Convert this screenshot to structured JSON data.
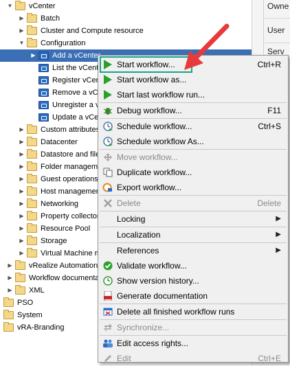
{
  "tree": [
    {
      "label": "vCenter",
      "indent": 0,
      "type": "folder",
      "twisty": "▼",
      "sel": false
    },
    {
      "label": "Batch",
      "indent": 1,
      "type": "folder",
      "twisty": "▶",
      "sel": false
    },
    {
      "label": "Cluster and Compute resource",
      "indent": 1,
      "type": "folder",
      "twisty": "▶",
      "sel": false
    },
    {
      "label": "Configuration",
      "indent": 1,
      "type": "folder",
      "twisty": "▼",
      "sel": false
    },
    {
      "label": "Add a vCenter",
      "indent": 2,
      "type": "wf",
      "twisty": "▶",
      "sel": true
    },
    {
      "label": "List the vCente",
      "indent": 2,
      "type": "wf",
      "twisty": "",
      "sel": false
    },
    {
      "label": "Register vCent",
      "indent": 2,
      "type": "wf",
      "twisty": "",
      "sel": false
    },
    {
      "label": "Remove a vCe",
      "indent": 2,
      "type": "wf",
      "twisty": "",
      "sel": false
    },
    {
      "label": "Unregister a v",
      "indent": 2,
      "type": "wf",
      "twisty": "",
      "sel": false
    },
    {
      "label": "Update a vCen",
      "indent": 2,
      "type": "wf",
      "twisty": "",
      "sel": false
    },
    {
      "label": "Custom attributes",
      "indent": 1,
      "type": "folder",
      "twisty": "▶",
      "sel": false
    },
    {
      "label": "Datacenter",
      "indent": 1,
      "type": "folder",
      "twisty": "▶",
      "sel": false
    },
    {
      "label": "Datastore and file",
      "indent": 1,
      "type": "folder",
      "twisty": "▶",
      "sel": false
    },
    {
      "label": "Folder manageme",
      "indent": 1,
      "type": "folder",
      "twisty": "▶",
      "sel": false
    },
    {
      "label": "Guest operations",
      "indent": 1,
      "type": "folder",
      "twisty": "▶",
      "sel": false
    },
    {
      "label": "Host management",
      "indent": 1,
      "type": "folder",
      "twisty": "▶",
      "sel": false
    },
    {
      "label": "Networking",
      "indent": 1,
      "type": "folder",
      "twisty": "▶",
      "sel": false
    },
    {
      "label": "Property collector",
      "indent": 1,
      "type": "folder",
      "twisty": "▶",
      "sel": false
    },
    {
      "label": "Resource Pool",
      "indent": 1,
      "type": "folder",
      "twisty": "▶",
      "sel": false
    },
    {
      "label": "Storage",
      "indent": 1,
      "type": "folder",
      "twisty": "▶",
      "sel": false
    },
    {
      "label": "Virtual Machine m",
      "indent": 1,
      "type": "folder",
      "twisty": "▶",
      "sel": false
    },
    {
      "label": "vRealize Automation",
      "indent": 0,
      "type": "folder",
      "twisty": "▶",
      "sel": false
    },
    {
      "label": "Workflow documenta",
      "indent": 0,
      "type": "folder",
      "twisty": "▶",
      "sel": false
    },
    {
      "label": "XML",
      "indent": 0,
      "type": "folder",
      "twisty": "▶",
      "sel": false
    },
    {
      "label": "PSO",
      "indent": -1,
      "type": "folder",
      "twisty": "",
      "sel": false
    },
    {
      "label": "System",
      "indent": -1,
      "type": "folder",
      "twisty": "",
      "sel": false
    },
    {
      "label": "vRA-Branding",
      "indent": -1,
      "type": "folder",
      "twisty": "",
      "sel": false
    }
  ],
  "right_panel": {
    "owner": "Owne",
    "user": "User",
    "serv": "Serv"
  },
  "menu": [
    {
      "label": "Start workflow...",
      "shortcut": "Ctrl+R",
      "icon": "play-icon",
      "disabled": false,
      "sub": false
    },
    {
      "label": "Start workflow as...",
      "shortcut": "",
      "icon": "play-icon",
      "disabled": false,
      "sub": false
    },
    {
      "label": "Start last workflow run...",
      "shortcut": "",
      "icon": "play-icon",
      "disabled": false,
      "sub": false
    },
    {
      "sep": true
    },
    {
      "label": "Debug workflow...",
      "shortcut": "F11",
      "icon": "bug-icon",
      "disabled": false,
      "sub": false
    },
    {
      "sep": true
    },
    {
      "label": "Schedule workflow...",
      "shortcut": "Ctrl+S",
      "icon": "clock-icon",
      "disabled": false,
      "sub": false
    },
    {
      "label": "Schedule workflow As...",
      "shortcut": "",
      "icon": "clock-icon",
      "disabled": false,
      "sub": false
    },
    {
      "sep": true
    },
    {
      "label": "Move workflow...",
      "shortcut": "",
      "icon": "move-icon",
      "disabled": true,
      "sub": false
    },
    {
      "label": "Duplicate workflow...",
      "shortcut": "",
      "icon": "duplicate-icon",
      "disabled": false,
      "sub": false
    },
    {
      "label": "Export workflow...",
      "shortcut": "",
      "icon": "export-icon",
      "disabled": false,
      "sub": false
    },
    {
      "sep": true
    },
    {
      "label": "Delete",
      "shortcut": "Delete",
      "icon": "delete-x-icon",
      "disabled": true,
      "sub": false
    },
    {
      "sep": true
    },
    {
      "label": "Locking",
      "shortcut": "",
      "icon": "",
      "disabled": false,
      "sub": true
    },
    {
      "sep": true
    },
    {
      "label": "Localization",
      "shortcut": "",
      "icon": "",
      "disabled": false,
      "sub": true
    },
    {
      "sep": true
    },
    {
      "label": "References",
      "shortcut": "",
      "icon": "",
      "disabled": false,
      "sub": true
    },
    {
      "label": "Validate workflow...",
      "shortcut": "",
      "icon": "check-icon",
      "disabled": false,
      "sub": false
    },
    {
      "label": "Show version history...",
      "shortcut": "",
      "icon": "history-icon",
      "disabled": false,
      "sub": false
    },
    {
      "label": "Generate documentation",
      "shortcut": "",
      "icon": "pdf-icon",
      "disabled": false,
      "sub": false
    },
    {
      "sep": true
    },
    {
      "label": "Delete all finished workflow runs",
      "shortcut": "",
      "icon": "delete-runs-icon",
      "disabled": false,
      "sub": false
    },
    {
      "sep": true
    },
    {
      "label": "Synchronize...",
      "shortcut": "",
      "icon": "sync-icon",
      "disabled": true,
      "sub": false
    },
    {
      "sep": true
    },
    {
      "label": "Edit access rights...",
      "shortcut": "",
      "icon": "users-icon",
      "disabled": false,
      "sub": false
    },
    {
      "label": "Edit",
      "shortcut": "Ctrl+E",
      "icon": "pencil-icon",
      "disabled": true,
      "sub": false
    }
  ],
  "colors": {
    "accent_highlight": "#1aa38a",
    "arrow": "#e83a3a",
    "play": "#2ca02c",
    "selection": "#3a6fb5"
  }
}
